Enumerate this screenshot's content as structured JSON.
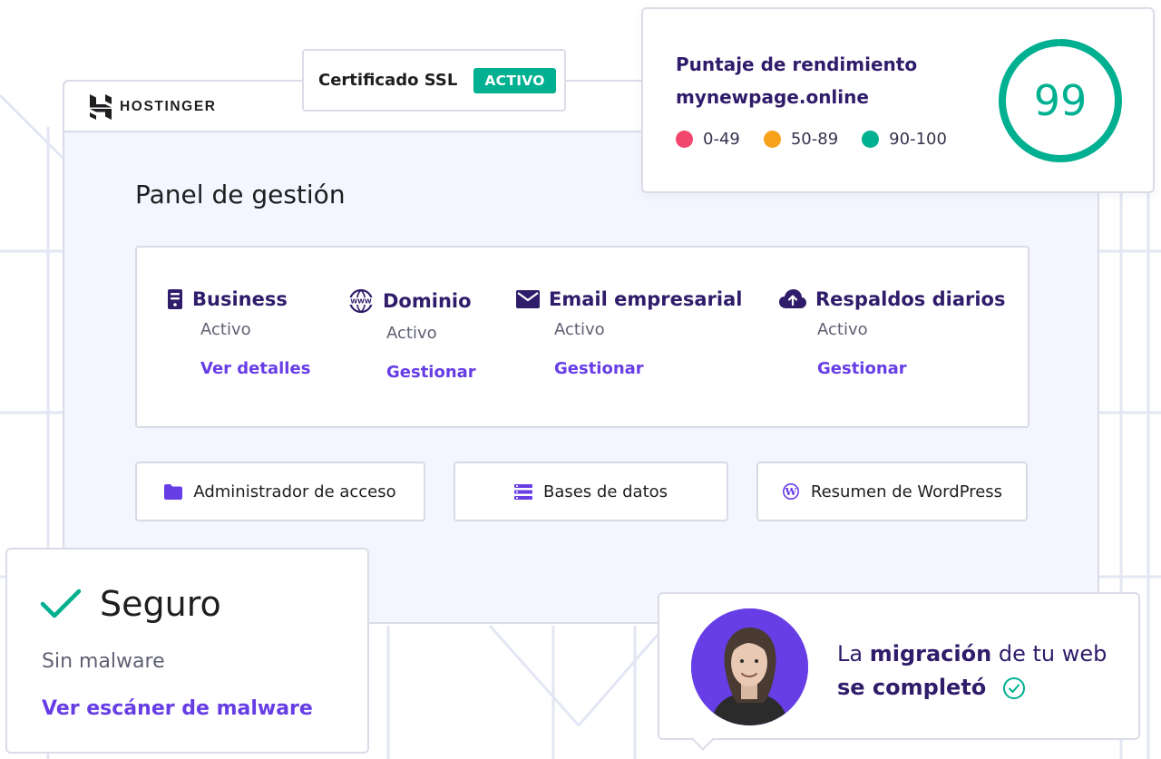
{
  "brand": {
    "name": "HOSTINGER"
  },
  "ssl": {
    "label": "Certificado SSL",
    "badge": "ACTIVO"
  },
  "performance": {
    "title": "Puntaje de rendimiento",
    "domain": "mynewpage.online",
    "score": "99",
    "score_fraction": 0.99,
    "legend": [
      {
        "label": "0-49",
        "color": "#f2466d"
      },
      {
        "label": "50-89",
        "color": "#f8a21c"
      },
      {
        "label": "90-100",
        "color": "#00b090"
      }
    ],
    "gauge_color": "#00b090"
  },
  "panel": {
    "title": "Panel de gestión"
  },
  "services": [
    {
      "icon": "server-icon",
      "name": "Business",
      "status": "Activo",
      "link": "Ver detalles"
    },
    {
      "icon": "www-globe-icon",
      "name": "Dominio",
      "status": "Activo",
      "link": "Gestionar"
    },
    {
      "icon": "envelope-icon",
      "name": "Email empresarial",
      "status": "Activo",
      "link": "Gestionar"
    },
    {
      "icon": "cloud-upload-icon",
      "name": "Respaldos diarios",
      "status": "Activo",
      "link": "Gestionar"
    }
  ],
  "quick_links": [
    {
      "icon": "folder-icon",
      "label": "Administrador de acceso"
    },
    {
      "icon": "database-list-icon",
      "label": "Bases de datos"
    },
    {
      "icon": "wordpress-icon",
      "label": "Resumen de WordPress"
    }
  ],
  "security": {
    "title": "Seguro",
    "subtitle": "Sin malware",
    "link": "Ver escáner de malware"
  },
  "migration": {
    "text_prefix": "La ",
    "text_bold": "migración",
    "text_suffix": " de tu web",
    "text_line2": "se completó"
  },
  "colors": {
    "accent": "#673de6",
    "dark_purple": "#2f1c6a",
    "success": "#00b090"
  }
}
